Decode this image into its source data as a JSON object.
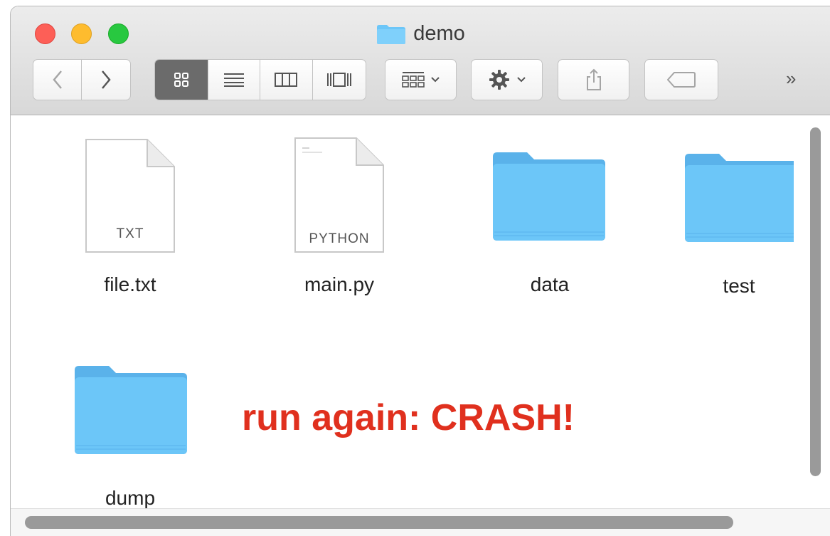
{
  "window": {
    "title": "demo"
  },
  "toolbar": {
    "back_icon": "chevron-left-icon",
    "forward_icon": "chevron-right-icon",
    "view_modes": [
      "icon-view",
      "list-view",
      "column-view",
      "cover-flow-view"
    ],
    "active_view": "icon-view",
    "arrange_icon": "arrange-grid-icon",
    "action_icon": "gear-icon",
    "share_icon": "share-icon",
    "tag_icon": "tag-icon",
    "more_label": "»"
  },
  "files": [
    {
      "name": "file.txt",
      "kind": "document",
      "badge": "TXT"
    },
    {
      "name": "main.py",
      "kind": "document",
      "badge": "PYTHON"
    },
    {
      "name": "data",
      "kind": "folder"
    },
    {
      "name": "test",
      "kind": "folder"
    },
    {
      "name": "dump",
      "kind": "folder"
    }
  ],
  "annotation": {
    "text": "run again: CRASH!",
    "color": "#e0301e"
  },
  "colors": {
    "folder": "#6cc6f8",
    "folder_dark": "#5ab2ea"
  }
}
